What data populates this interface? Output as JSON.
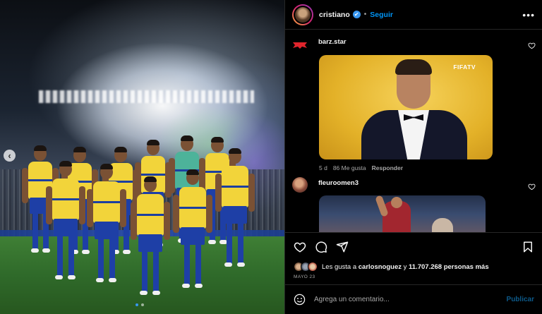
{
  "post": {
    "account": "cristiano",
    "verified_mark": "✔",
    "separator": "•",
    "follow_label": "Seguir",
    "more_label": "•••",
    "nav_prev": "‹"
  },
  "comments": [
    {
      "user": "barz.star",
      "gif_brand": "FIFATV",
      "time": "5 d",
      "likes": "86 Me gusta",
      "reply_label": "Responder"
    },
    {
      "user": "fleuroomen3"
    }
  ],
  "likes": {
    "prefix": "Les gusta a ",
    "user": "carlosnoguez",
    "middle": " y ",
    "count": "11.707.268 personas más"
  },
  "date": "MAYO 23",
  "comment_box": {
    "placeholder": "Agrega un comentario...",
    "publish_label": "Publicar"
  },
  "colors": {
    "accent": "#0095f6",
    "verified": "#3897f0",
    "background": "#000000",
    "jersey": "#f2d43a",
    "shorts": "#1e3fa6"
  },
  "icons": [
    "verified-icon",
    "more-icon",
    "heart-icon",
    "comment-icon",
    "share-icon",
    "save-icon",
    "emoji-icon",
    "chevron-left-icon"
  ]
}
